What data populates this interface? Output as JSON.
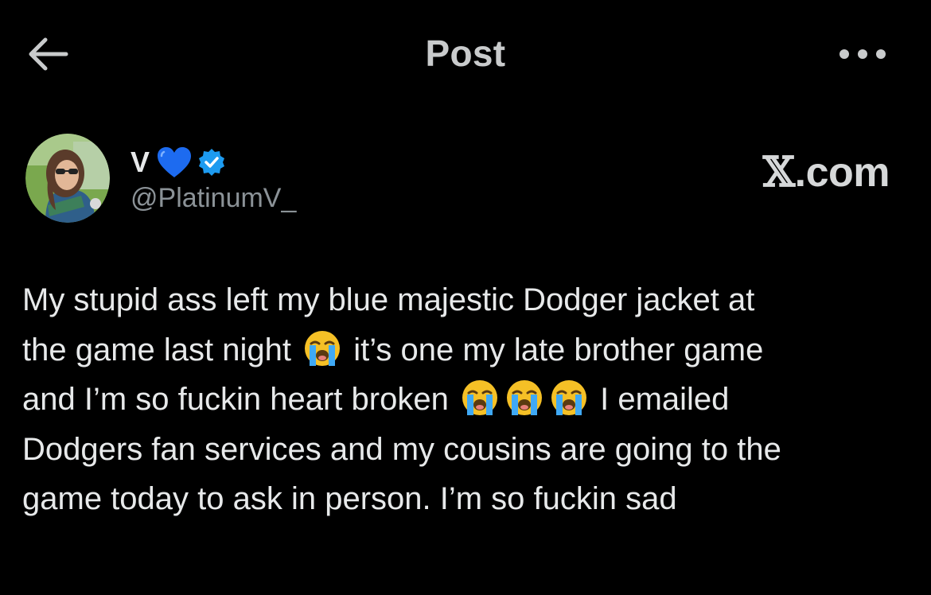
{
  "header": {
    "title": "Post",
    "back_icon": "arrow-left-icon",
    "more_icon": "more-horizontal-icon"
  },
  "author": {
    "display_name": "V",
    "name_emoji": "blue-heart-icon",
    "verified_icon": "verified-badge-icon",
    "handle": "@PlatinumV_"
  },
  "watermark": {
    "x": "𝕏",
    "domain": ".com"
  },
  "post": {
    "line1": "My stupid ass left my blue majestic Dodger jacket at",
    "line2a": "the game last night",
    "line2b": "it’s one my late brother game",
    "line3a": "and I’m so fuckin heart broken",
    "line3b": "I emailed",
    "line4": "Dodgers fan services and my cousins are going to the",
    "line5": "game today to ask in person. I’m so fuckin sad",
    "emoji": "loudly-crying-face-icon"
  },
  "colors": {
    "background": "#000000",
    "text": "#e7e9ea",
    "secondary": "#8b9297",
    "verified": "#1d9bf0"
  }
}
